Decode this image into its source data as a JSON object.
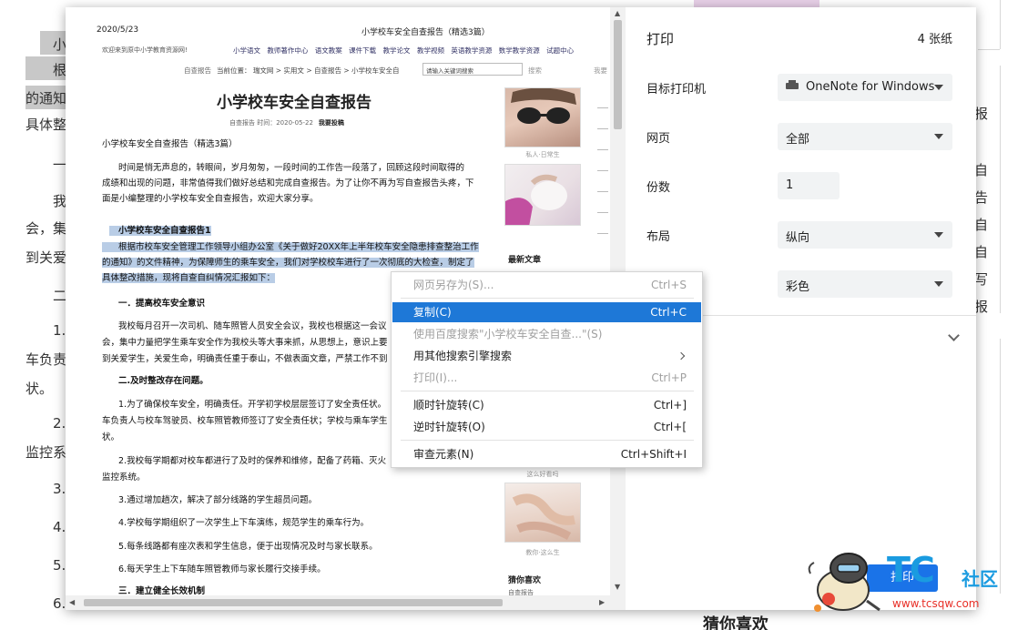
{
  "background": {
    "left_lines": [
      "小",
      "根",
      "的通知",
      "具体整",
      "一",
      "我",
      "会，集",
      "到关爱",
      "二",
      "1.",
      "车负责",
      "状。",
      "2.",
      "监控系",
      "3.",
      "4.",
      "5.",
      "6."
    ],
    "right_lines": [
      "报",
      "自",
      "告",
      "自",
      "自",
      "写",
      "报"
    ],
    "bottom_right_heading": "猜你喜欢"
  },
  "preview": {
    "date": "2020/5/23",
    "header_title": "小学校车安全自查报告（精选3篇）",
    "welcome": "欢迎来到原中小学教育资源网!",
    "nav": [
      "小学语文",
      "教师著作中心",
      "语文教案",
      "课件下载",
      "教学论文",
      "教学视频",
      "英语教学资源",
      "数学教学资源",
      "试题中心"
    ],
    "row2_left": "自查报告",
    "breadcrumb": "当前位置：  瑞文网 > 实用文 > 自查报告 > 小学校车安全自",
    "search_placeholder": "请输入关键词搜索",
    "search_button": "搜索",
    "ask": "我要",
    "title": "小学校车安全自查报告",
    "meta": "自查报告   时间：2020-05-22",
    "meta_link": "我要投稿",
    "subtitle": "小学校车安全自查报告（精选3篇）",
    "intro_1": "时间是悄无声息的，转眼间，岁月匆匆，一段时间的工作告一段落了，回顾这段时间取得的",
    "intro_2": "成绩和出现的问题，非常值得我们做好总结和完成自查报告。为了让你不再为写自查报告头疼，下",
    "intro_3": "面是小编整理的小学校车安全自查报告，欢迎大家分享。",
    "sel_heading": "小学校车安全自查报告1",
    "sel_1": "根据市校车安全管理工作领导小组办公室《关于做好20XX年上半年校车安全隐患排查整治工作",
    "sel_2": "的通知》的文件精神，为保障师生的乘车安全，我们对学校校车进行了一次彻底的大检查，制定了",
    "sel_3": "具体整改措施，现将自查自纠情况汇报如下：",
    "h1": "一．提高校车安全意识",
    "p1_1": "我校每月召开一次司机、随车照管人员安全会议，我校也根据这一会议",
    "p1_2": "会，集中力量把学生乘车安全作为我校头等大事来抓，从思想上，意识上要",
    "p1_3": "到关爱学生，关爱生命，明确责任重于泰山，不做表面文章，严禁工作不到",
    "h2": "二.及时整改存在问题。",
    "p2_1": "1.为了确保校车安全，明确责任。开学初学校层层签订了安全责任状。",
    "p2_2": "车负责人与校车驾驶员、校车照管教师签订了安全责任状；学校与乘车学生",
    "p2_3": "状。",
    "p3_1": "2.我校每学期都对校车都进行了及时的保养和维修，配备了药箱、灭火",
    "p3_2": "监控系统。",
    "p4": "3.通过增加趟次，解决了部分线路的学生超员问题。",
    "p5": "4.学校每学期组织了一次学生上下车演练，规范学生的乘车行为。",
    "p6": "5.每条线路都有座次表和学生信息，便于出现情况及时与家长联系。",
    "p7": "6.每天学生上下车随车照管教师与家长履行交接手续。",
    "h3": "三．建立健全长效机制",
    "side_caption_1": "私人·日常生",
    "side_latest": "最新文章",
    "side_caption_2": "这么好看吗",
    "side_caption_3": "教你·这么生",
    "side_like": "猜你喜欢",
    "side_like_sub": "自查报告"
  },
  "settings": {
    "title": "打印",
    "sheet_count": "4 张纸",
    "destination_label": "目标打印机",
    "destination_value": "OneNote for Windows",
    "pages_label": "网页",
    "pages_value": "全部",
    "copies_label": "份数",
    "copies_value": "1",
    "layout_label": "布局",
    "layout_value": "纵向",
    "color_value": "彩色",
    "print_button": "打印"
  },
  "context_menu": {
    "items": [
      {
        "label": "网页另存为(S)...",
        "shortcut": "Ctrl+S",
        "state": "disabled"
      },
      {
        "label": "复制(C)",
        "shortcut": "Ctrl+C",
        "state": "hover"
      },
      {
        "label": "使用百度搜索\"小学校车安全自查...\"(S)",
        "shortcut": "",
        "state": "disabled"
      },
      {
        "label": "用其他搜索引擎搜索",
        "shortcut": "",
        "state": "enabled"
      },
      {
        "label": "打印(I)...",
        "shortcut": "Ctrl+P",
        "state": "disabled"
      },
      {
        "label": "顺时针旋转(C)",
        "shortcut": "Ctrl+]",
        "state": "enabled"
      },
      {
        "label": "逆时针旋转(O)",
        "shortcut": "Ctrl+[",
        "state": "enabled"
      },
      {
        "label": "审查元素(N)",
        "shortcut": "Ctrl+Shift+I",
        "state": "enabled"
      }
    ]
  },
  "watermark": {
    "brand": "TC",
    "brand_suffix": "社区",
    "url": "www.tcsqw.com"
  },
  "colors": {
    "accent_blue": "#1a73e8",
    "menu_highlight": "#1e78d7",
    "selection": "#b9cde6",
    "watermark_red": "#e83028",
    "watermark_blue": "#1a9be0"
  }
}
